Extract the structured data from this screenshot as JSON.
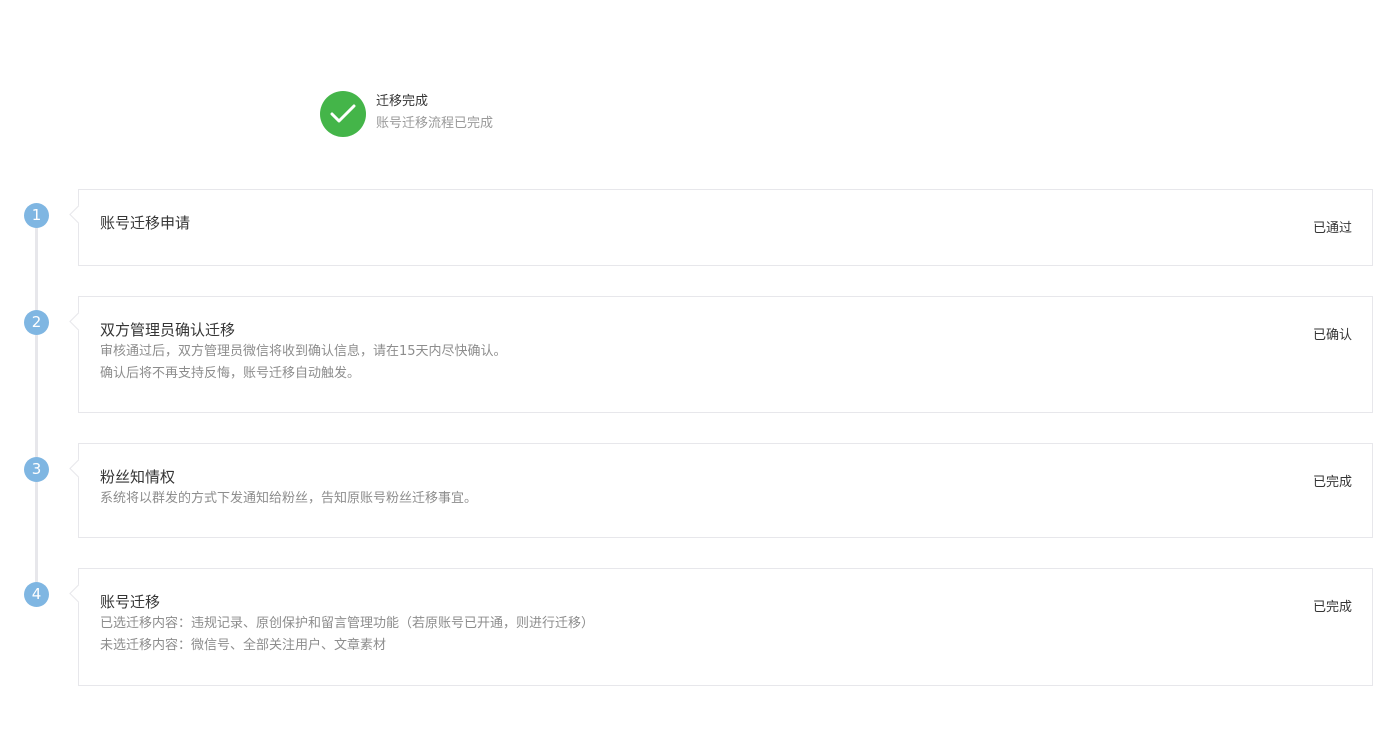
{
  "result": {
    "icon": "check-circle-icon",
    "title": "迁移完成",
    "desc": "账号迁移流程已完成",
    "color": "#44b549"
  },
  "steps": [
    {
      "number": "1",
      "title": "账号迁移申请",
      "lines": [],
      "status": "已通过"
    },
    {
      "number": "2",
      "title": "双方管理员确认迁移",
      "lines": [
        "审核通过后，双方管理员微信将收到确认信息，请在15天内尽快确认。",
        "确认后将不再支持反悔，账号迁移自动触发。"
      ],
      "status": "已确认"
    },
    {
      "number": "3",
      "title": "粉丝知情权",
      "lines": [
        "系统将以群发的方式下发通知给粉丝，告知原账号粉丝迁移事宜。"
      ],
      "status": "已完成"
    },
    {
      "number": "4",
      "title": "账号迁移",
      "lines": [
        "已选迁移内容：违规记录、原创保护和留言管理功能（若原账号已开通，则进行迁移）",
        "未选迁移内容：微信号、全部关注用户、文章素材"
      ],
      "status": "已完成"
    }
  ],
  "colors": {
    "step_circle": "#7fb6e2",
    "border": "#e7e7eb"
  }
}
